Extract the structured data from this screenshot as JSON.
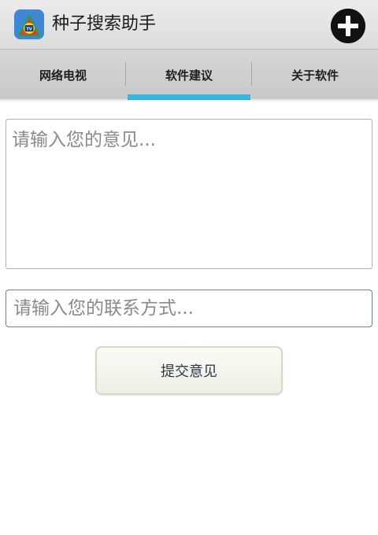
{
  "app": {
    "title": "种子搜索助手",
    "icon_name": "tv-app-icon",
    "add_icon": "plus-circle-icon"
  },
  "tabs": [
    {
      "label": "网络电视",
      "active": false
    },
    {
      "label": "软件建议",
      "active": true
    },
    {
      "label": "关于软件",
      "active": false
    }
  ],
  "form": {
    "opinion_placeholder": "请输入您的意见...",
    "contact_placeholder": "请输入您的联系方式...",
    "submit_label": "提交意见"
  },
  "colors": {
    "tab_indicator": "#33b5e5",
    "action_bar": "#e4e4e4",
    "tab_bar": "#d0d0d0"
  }
}
